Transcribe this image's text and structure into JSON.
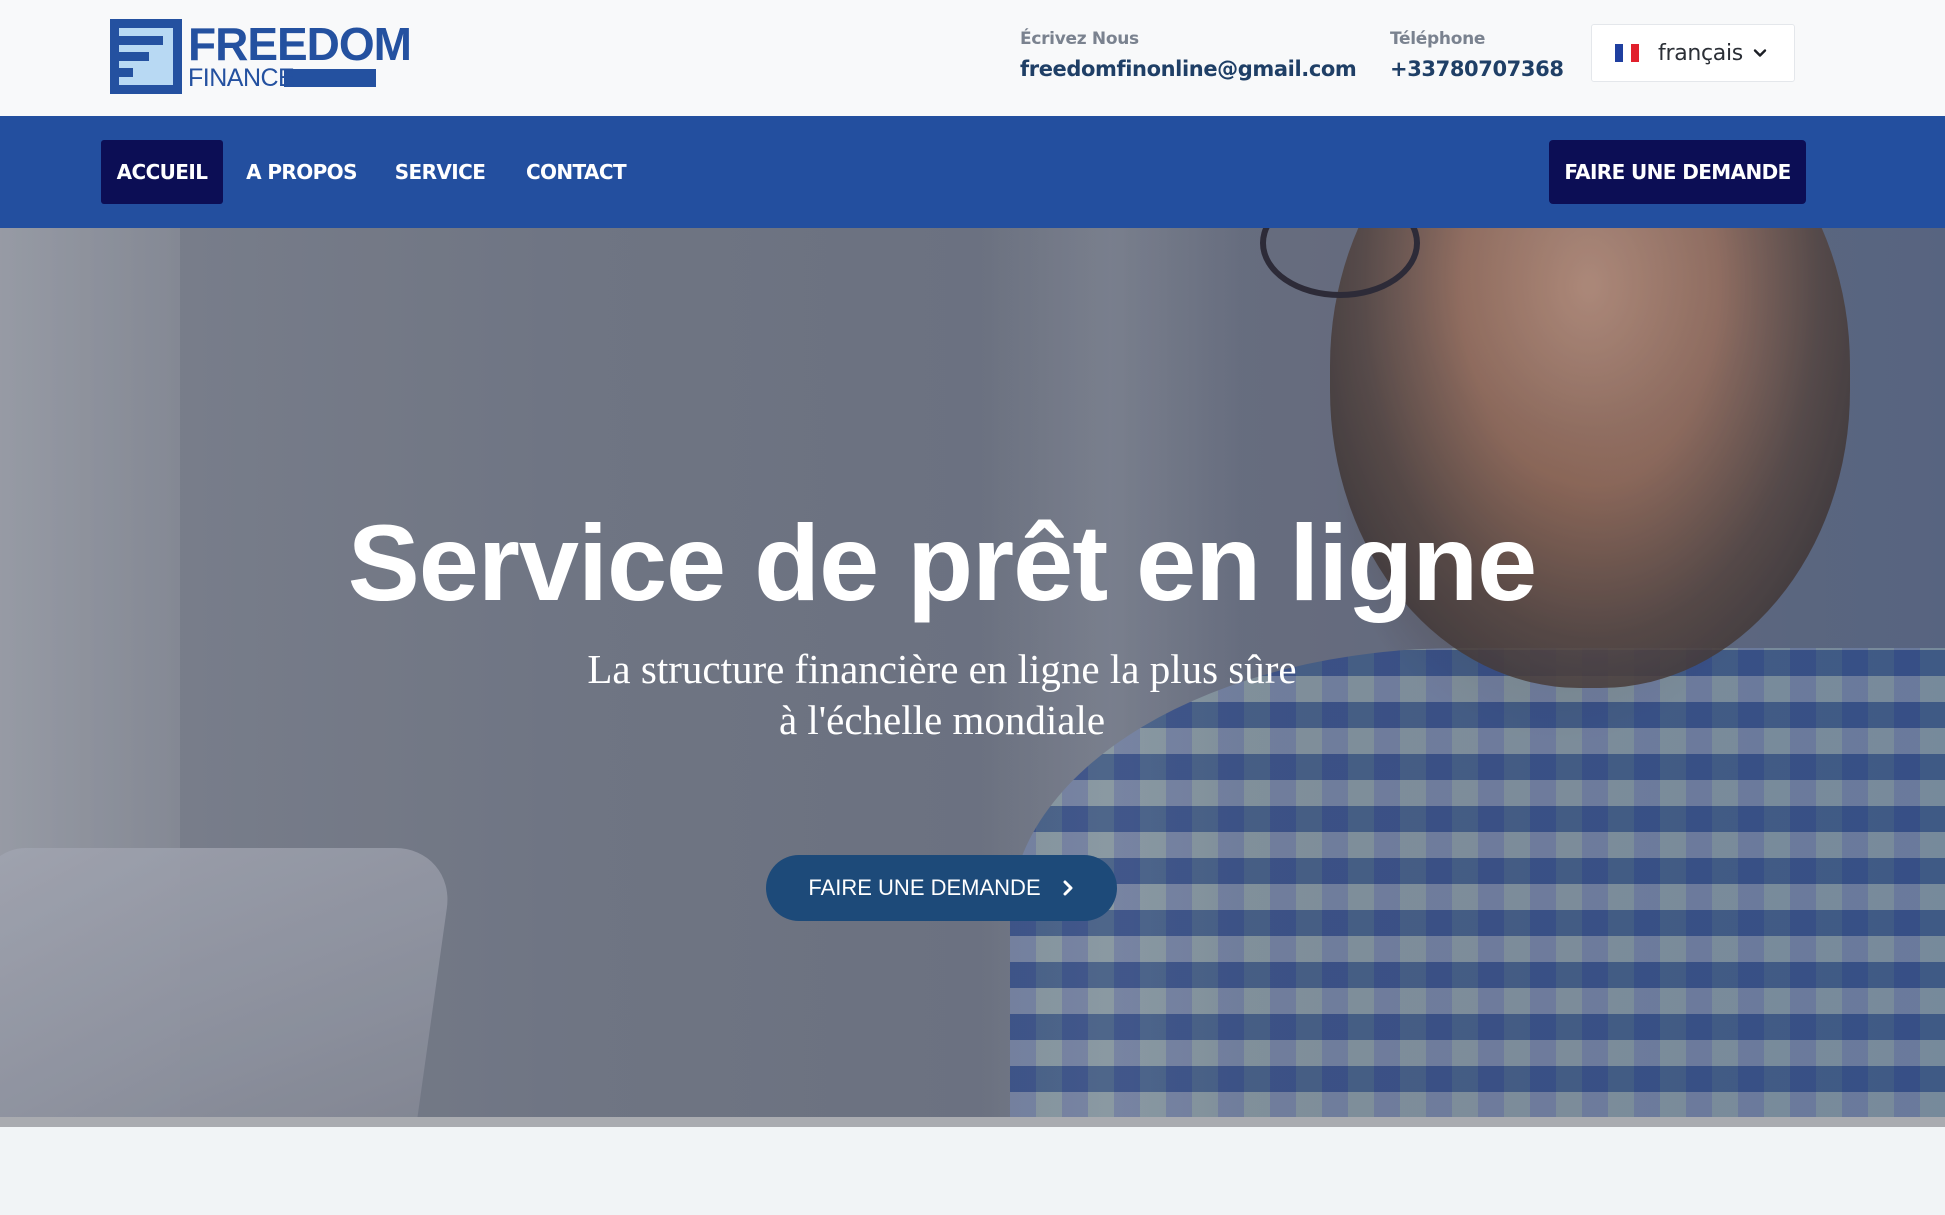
{
  "brand": {
    "name_line1": "FREEDOM",
    "name_line2": "FINANCE",
    "primary_color": "#2451a0",
    "accent_color": "#b8d9f3"
  },
  "contact": {
    "email_label": "Écrivez Nous",
    "email_value": "freedomfinonline@gmail.com",
    "phone_label": "Téléphone",
    "phone_value": "+33780707368"
  },
  "language": {
    "selected": "français",
    "flag_icon": "france-flag-icon",
    "dropdown_icon": "chevron-down-icon"
  },
  "nav": {
    "items": [
      {
        "label": "ACCUEIL",
        "active": true
      },
      {
        "label": "A PROPOS",
        "active": false
      },
      {
        "label": "SERVICE",
        "active": false
      },
      {
        "label": "CONTACT",
        "active": false
      }
    ],
    "cta_label": "FAIRE UNE DEMANDE",
    "bar_color": "#234f9f",
    "active_color": "#0c0e55"
  },
  "hero": {
    "title": "Service de prêt en ligne",
    "subtitle_line1": "La structure financière en ligne la plus sûre",
    "subtitle_line2": "à l'échelle mondiale",
    "button_label": "FAIRE UNE DEMANDE",
    "button_icon": "chevron-right-icon",
    "button_color": "#1d4a79"
  }
}
